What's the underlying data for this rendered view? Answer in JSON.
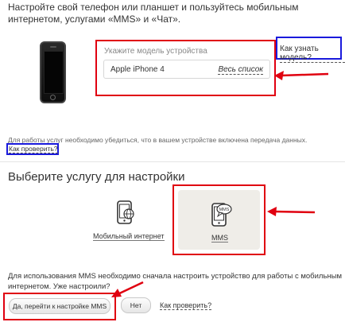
{
  "intro": {
    "text": "Настройте свой телефон или планшет и пользуйтесь мобильным интернетом, услугами «MMS» и «Чат»."
  },
  "device": {
    "label": "Укажите модель устройства",
    "model_value": "Apple iPhone 4",
    "all_list_link": "Весь список",
    "how_to_find_link": "Как узнать модель?"
  },
  "data_check": {
    "note": "Для работы услуг необходимо убедиться, что в вашем устройстве включена передача данных.",
    "check_link": "Как проверить?"
  },
  "services": {
    "heading": "Выберите услугу для настройки",
    "items": [
      {
        "label": "Мобильный интернет",
        "icon": "phone-globe-icon"
      },
      {
        "label": "MMS",
        "icon": "phone-mms-icon",
        "selected": true
      }
    ]
  },
  "confirm": {
    "question": "Для использования MMS необходимо сначала настроить устройство для работы с мобильным интернетом. Уже настроили?",
    "yes_button": "Да, перейти к настройке MMS",
    "no_button": "Нет",
    "check_link": "Как проверить?"
  },
  "colors": {
    "highlight_red": "#e00010",
    "highlight_blue": "#1a1adc",
    "selected_panel": "#efede8"
  }
}
